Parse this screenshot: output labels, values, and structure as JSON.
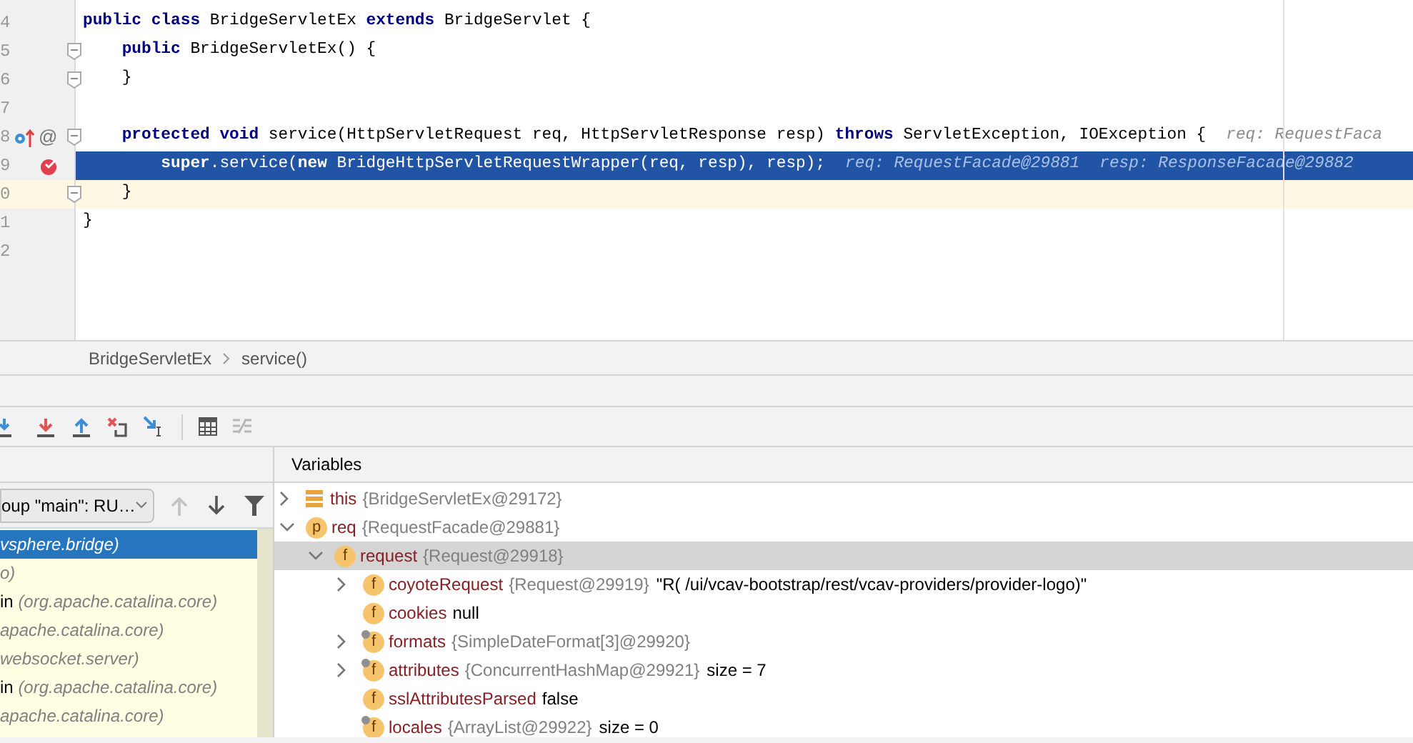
{
  "editor": {
    "lines": [
      {
        "number": "4",
        "execution": false,
        "caret_line": false,
        "fold": false,
        "tokens": [
          {
            "kind": "kw",
            "text": "public"
          },
          {
            "kind": "kw",
            "text": " class"
          },
          {
            "kind": "plain",
            "text": " BridgeServletEx "
          },
          {
            "kind": "kw",
            "text": "extends"
          },
          {
            "kind": "plain",
            "text": " BridgeServlet {"
          }
        ]
      },
      {
        "number": "5",
        "execution": false,
        "caret_line": false,
        "fold": true,
        "tokens": [
          {
            "kind": "kw",
            "text": "    public"
          },
          {
            "kind": "plain",
            "text": " BridgeServletEx() {"
          }
        ]
      },
      {
        "number": "6",
        "execution": false,
        "caret_line": false,
        "fold": true,
        "tokens": [
          {
            "kind": "plain",
            "text": "    }"
          }
        ]
      },
      {
        "number": "7",
        "execution": false,
        "caret_line": false,
        "fold": false
      },
      {
        "number": "8",
        "execution": false,
        "caret_line": false,
        "fold": true,
        "gutter": [
          {
            "kind": "override"
          },
          {
            "kind": "glyph",
            "text": "@"
          }
        ],
        "tokens": [
          {
            "kind": "kw",
            "text": "    protected"
          },
          {
            "kind": "kw",
            "text": " void"
          },
          {
            "kind": "plain",
            "text": " service(HttpServletRequest req, HttpServletResponse resp) "
          },
          {
            "kind": "kw",
            "text": "throws"
          },
          {
            "kind": "plain",
            "text": " ServletException, IOException {"
          },
          {
            "kind": "hint",
            "text": "req: RequestFaca"
          }
        ]
      },
      {
        "number": "9",
        "execution": true,
        "caret_line": false,
        "fold": false,
        "gutter": [
          {
            "kind": "breakpoint"
          }
        ],
        "tokens": [
          {
            "kind": "kw",
            "text": "        super"
          },
          {
            "kind": "plain",
            "text": ".service("
          },
          {
            "kind": "kw",
            "text": "new"
          },
          {
            "kind": "plain",
            "text": " BridgeHttpServletRequestWrapper(req, resp), resp);"
          },
          {
            "kind": "hint",
            "text": "req: RequestFacade@29881"
          },
          {
            "kind": "hint",
            "text": "resp: ResponseFacade@29882"
          }
        ]
      },
      {
        "number": "0",
        "execution": false,
        "caret_line": true,
        "fold": true,
        "tokens": [
          {
            "kind": "plain",
            "text": "    }"
          }
        ]
      },
      {
        "number": "1",
        "execution": false,
        "caret_line": false,
        "fold": false,
        "tokens": [
          {
            "kind": "plain",
            "text": "}"
          }
        ]
      },
      {
        "number": "2",
        "execution": false,
        "caret_line": false,
        "fold": false
      }
    ]
  },
  "breadcrumb": [
    "BridgeServletEx",
    "service()"
  ],
  "frames": {
    "thread_dropdown": "oup \"main\": RU…",
    "items": [
      {
        "location": "vsphere.bridge)",
        "selected": true
      },
      {
        "location": "o)",
        "selected": false
      },
      {
        "method": "in ",
        "location": "(org.apache.catalina.core)",
        "selected": false
      },
      {
        "location": "apache.catalina.core)",
        "selected": false
      },
      {
        "location": "websocket.server)",
        "selected": false
      },
      {
        "method": "in ",
        "location": "(org.apache.catalina.core)",
        "selected": false
      },
      {
        "location": "apache.catalina.core)",
        "selected": false
      }
    ]
  },
  "variables": {
    "title": "Variables",
    "items": [
      {
        "kind": "object",
        "name": "this",
        "value": "{BridgeServletEx@29172}",
        "dimmed": true,
        "expanded": false,
        "selected": false,
        "pinned": false
      },
      {
        "kind": "badge",
        "badge": "p",
        "name": "req",
        "value": "{RequestFacade@29881}",
        "dimmed": true,
        "expanded": true,
        "selected": false,
        "pinned": false,
        "children": [
          {
            "kind": "badge",
            "badge": "f",
            "name": "request",
            "value": "{Request@29918}",
            "dimmed": true,
            "expanded": true,
            "selected": true,
            "pinned": false,
            "children": [
              {
                "kind": "badge",
                "badge": "f",
                "name": "coyoteRequest",
                "value": "{Request@29919}",
                "extra": "\"R( /ui/vcav-bootstrap/rest/vcav-providers/provider-logo)\"",
                "dimmed": true,
                "expanded": false,
                "selected": false,
                "pinned": false
              },
              {
                "kind": "badge",
                "badge": "f",
                "name": "cookies",
                "value": "null",
                "dimmed": false,
                "selected": false,
                "pinned": false
              },
              {
                "kind": "badge",
                "badge": "f",
                "name": "formats",
                "value": "{SimpleDateFormat[3]@29920}",
                "dimmed": true,
                "expanded": false,
                "selected": false,
                "pinned": true
              },
              {
                "kind": "badge",
                "badge": "f",
                "name": "attributes",
                "value": "{ConcurrentHashMap@29921}",
                "extra": "size = 7",
                "dimmed": true,
                "expanded": false,
                "selected": false,
                "pinned": true
              },
              {
                "kind": "badge",
                "badge": "f",
                "name": "sslAttributesParsed",
                "value": "false",
                "dimmed": false,
                "selected": false,
                "pinned": false
              },
              {
                "kind": "badge",
                "badge": "f",
                "name": "locales",
                "value": "{ArrayList@29922}",
                "extra": "size = 0",
                "dimmed": true,
                "selected": false,
                "pinned": true
              }
            ]
          }
        ]
      }
    ]
  }
}
